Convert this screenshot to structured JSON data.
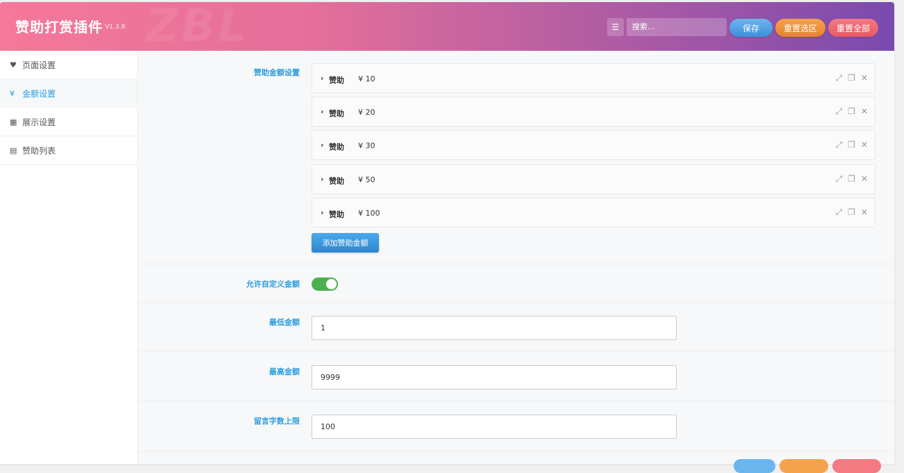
{
  "header": {
    "title": "赞助打赏插件",
    "version": "V1.3.8",
    "watermark": "ZBL",
    "search_placeholder": "搜索...",
    "save_label": "保存",
    "reset_section_label": "重置选区",
    "reset_all_label": "重置全部"
  },
  "sidebar": {
    "items": [
      {
        "label": "页面设置",
        "icon": "heart-icon"
      },
      {
        "label": "金额设置",
        "icon": "yen-icon"
      },
      {
        "label": "展示设置",
        "icon": "grid-icon"
      },
      {
        "label": "赞助列表",
        "icon": "list-icon"
      }
    ],
    "active_index": 1
  },
  "main": {
    "amounts_label": "赞助金额设置",
    "amounts": [
      {
        "title": "赞助",
        "amount": "¥ 10"
      },
      {
        "title": "赞助",
        "amount": "¥ 20"
      },
      {
        "title": "赞助",
        "amount": "¥ 30"
      },
      {
        "title": "赞助",
        "amount": "¥ 50"
      },
      {
        "title": "赞助",
        "amount": "¥ 100"
      }
    ],
    "add_amount_label": "添加赞助金额",
    "custom_amount_label": "允许自定义金额",
    "custom_amount_enabled": true,
    "min_amount_label": "最低金额",
    "min_amount_value": "1",
    "max_amount_label": "最高金额",
    "max_amount_value": "9999",
    "message_limit_label": "留言字数上限",
    "message_limit_value": "100"
  },
  "colors": {
    "accent": "#2b9de0",
    "toggle_on": "#4caf50",
    "save": "#3d8fdc",
    "reset_section": "#e6832a",
    "reset_all": "#e55a64"
  }
}
